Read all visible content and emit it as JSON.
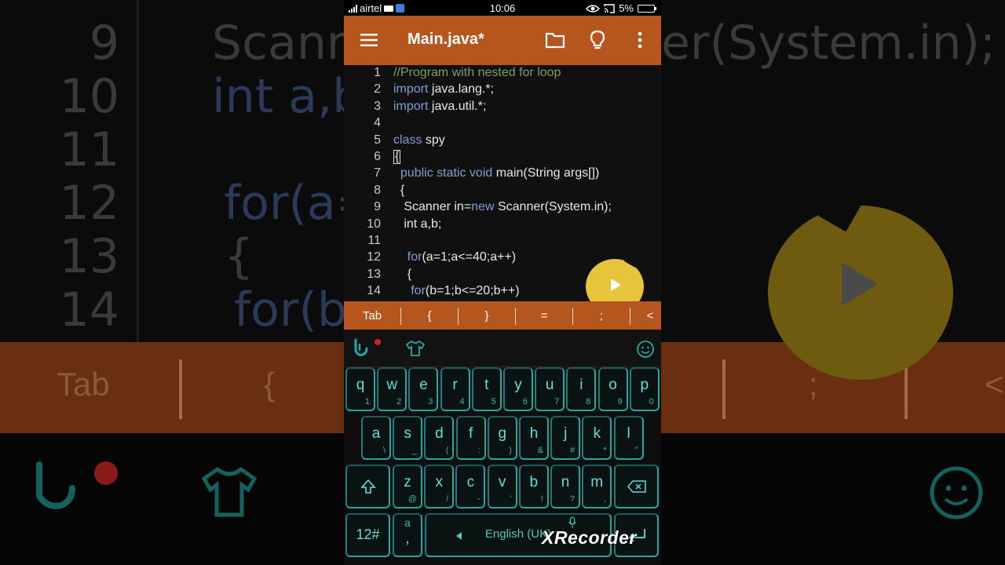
{
  "status_bar": {
    "carrier": "airtel",
    "time": "10:06",
    "battery": "5%"
  },
  "app_bar": {
    "title": "Main.java*"
  },
  "icons": {
    "menu": "hamburger-menu-icon",
    "folder": "folder-icon",
    "hint": "lightbulb-icon",
    "more": "more-vertical-icon",
    "run": "play-icon"
  },
  "colors": {
    "accent": "#b5561e",
    "keyword": "#7d9fd6",
    "comment": "#7a9e6a",
    "key_border": "#25a8a2",
    "fab": "#e6c43b"
  },
  "editor": {
    "lines": [
      {
        "num": "1",
        "parts": [
          {
            "t": "//Program with nested for loop",
            "c": "cm"
          }
        ]
      },
      {
        "num": "2",
        "parts": [
          {
            "t": "import",
            "c": "kw"
          },
          {
            "t": " java.lang.*;",
            "c": ""
          }
        ]
      },
      {
        "num": "3",
        "parts": [
          {
            "t": "import",
            "c": "kw"
          },
          {
            "t": " java.util.*;",
            "c": ""
          }
        ]
      },
      {
        "num": "4",
        "parts": []
      },
      {
        "num": "5",
        "parts": [
          {
            "t": "class",
            "c": "kw"
          },
          {
            "t": " spy",
            "c": ""
          }
        ]
      },
      {
        "num": "6",
        "parts": [
          {
            "t": "{",
            "c": "cur"
          }
        ]
      },
      {
        "num": "7",
        "parts": [
          {
            "t": "  ",
            "c": ""
          },
          {
            "t": "public static void",
            "c": "kw"
          },
          {
            "t": " main(String args[])",
            "c": ""
          }
        ]
      },
      {
        "num": "8",
        "parts": [
          {
            "t": "  {",
            "c": ""
          }
        ]
      },
      {
        "num": "9",
        "parts": [
          {
            "t": "   Scanner in=",
            "c": ""
          },
          {
            "t": "new",
            "c": "kw"
          },
          {
            "t": " Scanner(System.in);",
            "c": ""
          }
        ]
      },
      {
        "num": "10",
        "parts": [
          {
            "t": "   int a,b;",
            "c": ""
          }
        ]
      },
      {
        "num": "11",
        "parts": []
      },
      {
        "num": "12",
        "parts": [
          {
            "t": "    ",
            "c": ""
          },
          {
            "t": "for",
            "c": "kw"
          },
          {
            "t": "(a=1;a<=40;a++)",
            "c": ""
          }
        ]
      },
      {
        "num": "13",
        "parts": [
          {
            "t": "    {",
            "c": ""
          }
        ]
      },
      {
        "num": "14",
        "parts": [
          {
            "t": "     ",
            "c": ""
          },
          {
            "t": "for",
            "c": "kw"
          },
          {
            "t": "(b=1;b<=20;b++)",
            "c": ""
          }
        ]
      }
    ]
  },
  "symbol_bar": [
    "Tab",
    "{",
    "}",
    "=",
    ";",
    "<"
  ],
  "keyboard": {
    "row1": [
      [
        "q",
        "1"
      ],
      [
        "w",
        "2"
      ],
      [
        "e",
        "3"
      ],
      [
        "r",
        "4"
      ],
      [
        "t",
        "5"
      ],
      [
        "y",
        "6"
      ],
      [
        "u",
        "7"
      ],
      [
        "i",
        "8"
      ],
      [
        "o",
        "9"
      ],
      [
        "p",
        "0"
      ]
    ],
    "row2": [
      [
        "a",
        "\\"
      ],
      [
        "s",
        "_"
      ],
      [
        "d",
        "("
      ],
      [
        "f",
        ":"
      ],
      [
        "g",
        ")"
      ],
      [
        "h",
        "&"
      ],
      [
        "j",
        "#"
      ],
      [
        "k",
        "*"
      ],
      [
        "l",
        "\""
      ]
    ],
    "row3": [
      [
        "z",
        "@"
      ],
      [
        "x",
        "/"
      ],
      [
        "c",
        "-"
      ],
      [
        "v",
        "'"
      ],
      [
        "b",
        "!"
      ],
      [
        "n",
        "?"
      ],
      [
        "m",
        ","
      ]
    ],
    "symbols_key": "12#",
    "comma_key": ",",
    "comma_key_alt": "a",
    "space_label": "English (UK)"
  },
  "watermark": "XRecorder",
  "background": {
    "line_numbers": [
      "9",
      "10",
      "11",
      "12",
      "13",
      "14"
    ],
    "code_fragments": [
      "Scanne",
      "er(System.in);",
      "int a,b;",
      "for(a=",
      "{",
      "for(b="
    ],
    "bar_labels": [
      "Tab",
      "{",
      ";",
      "<"
    ]
  }
}
